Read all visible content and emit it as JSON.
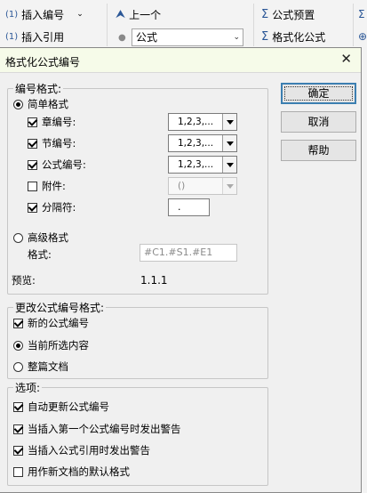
{
  "ribbon": {
    "insert_number": "插入编号",
    "insert_reference": "插入引用",
    "previous": "上一个",
    "equation_combo_value": "公式",
    "equation_preset": "公式预置",
    "format_equation": "格式化公式"
  },
  "dialog": {
    "title": "格式化公式编号",
    "buttons": {
      "ok": "确定",
      "cancel": "取消",
      "help": "帮助"
    },
    "number_format": {
      "legend": "编号格式:",
      "simple": {
        "label": "简单格式",
        "selected": true
      },
      "chapter": {
        "label": "章编号:",
        "checked": true,
        "value": "1,2,3,..."
      },
      "section": {
        "label": "节编号:",
        "checked": true,
        "value": "1,2,3,..."
      },
      "equation": {
        "label": "公式编号:",
        "checked": true,
        "value": "1,2,3,..."
      },
      "appendix": {
        "label": "附件:",
        "checked": false,
        "value": "()"
      },
      "separator": {
        "label": "分隔符:",
        "checked": true,
        "value": "."
      },
      "advanced": {
        "label": "高级格式",
        "selected": false
      },
      "format_label": "格式:",
      "format_value": "#C1.#S1.#E1",
      "preview_label": "预览:",
      "preview_value": "1.1.1"
    },
    "change_format": {
      "legend": "更改公式编号格式:",
      "new_numbers": {
        "label": "新的公式编号",
        "checked": true
      },
      "current_selection": {
        "label": "当前所选内容",
        "selected": true
      },
      "whole_document": {
        "label": "整篇文档",
        "selected": false
      }
    },
    "options": {
      "legend": "选项:",
      "auto_update": {
        "label": "自动更新公式编号",
        "checked": true
      },
      "warn_first_number": {
        "label": "当插入第一个公式编号时发出警告",
        "checked": true
      },
      "warn_reference": {
        "label": "当插入公式引用时发出警告",
        "checked": true
      },
      "default_new_docs": {
        "label": "用作新文档的默认格式",
        "checked": false
      }
    }
  }
}
